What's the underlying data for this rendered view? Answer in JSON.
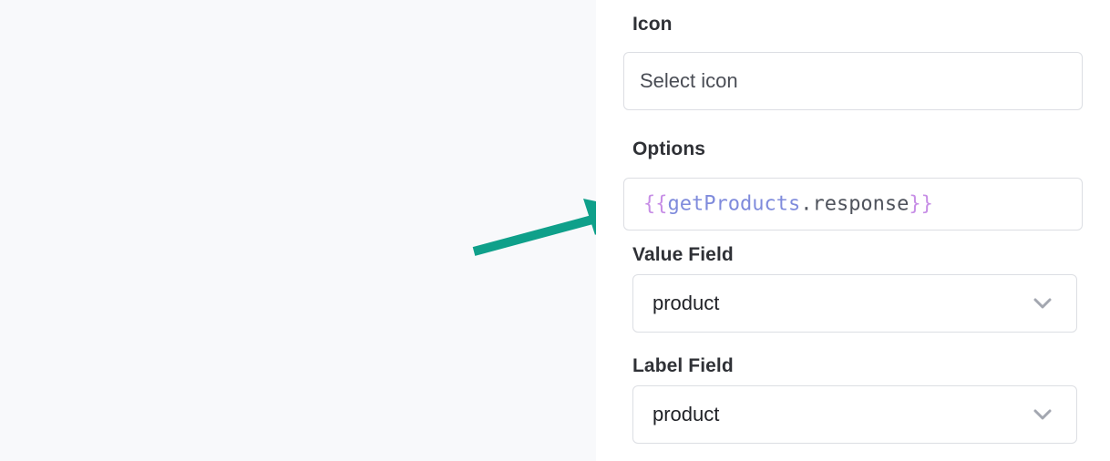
{
  "icon_field": {
    "label": "Icon",
    "placeholder": "Select icon"
  },
  "options_field": {
    "label": "Options",
    "code": {
      "open": "{{",
      "identifier": "getProducts",
      "dot": ".",
      "property": "response",
      "close": "}}"
    }
  },
  "value_field": {
    "label": "Value Field",
    "selected": "product",
    "icon": "chevron-down-icon"
  },
  "label_field": {
    "label": "Label Field",
    "selected": "product",
    "icon": "chevron-down-icon"
  },
  "annotation": {
    "icon": "arrow-icon",
    "color": "#0fa08a"
  },
  "colors": {
    "brace": "#c78ee6",
    "identifier": "#7f8bdc",
    "property": "#4f535c",
    "chevron": "#a3a7b0"
  }
}
